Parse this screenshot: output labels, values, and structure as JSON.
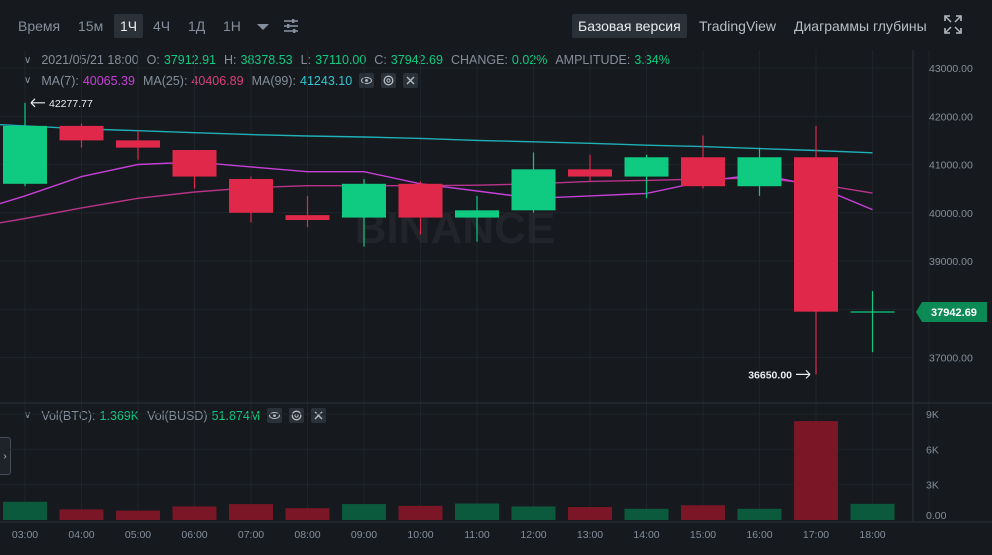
{
  "toolbar": {
    "intervals": [
      "Время",
      "15м",
      "1Ч",
      "4Ч",
      "1Д",
      "1Н"
    ],
    "active_interval": "1Ч",
    "views": [
      "Базовая версия",
      "TradingView",
      "Диаграммы глубины"
    ],
    "active_view": "Базовая версия"
  },
  "legend": {
    "date": "2021/05/21 18:00",
    "o_label": "O:",
    "o": "37912.91",
    "h_label": "H:",
    "h": "38378.53",
    "l_label": "L:",
    "l": "37110.00",
    "c_label": "C:",
    "c": "37942.69",
    "change_label": "CHANGE:",
    "change": "0.02%",
    "amp_label": "AMPLITUDE:",
    "amp": "3.34%",
    "ma7_label": "MA(7):",
    "ma7": "40065.39",
    "ma25_label": "MA(25):",
    "ma25": "40406.89",
    "ma99_label": "MA(99):",
    "ma99": "41243.10",
    "vol_btc_label": "Vol(BTC):",
    "vol_btc": "1.369K",
    "vol_busd_label": "Vol(BUSD)",
    "vol_busd": "51.874M"
  },
  "markers": {
    "high": "42277.77",
    "low": "36650.00",
    "last_price": "37942.69"
  },
  "watermark": "BINANCE",
  "colors": {
    "up": "#0ecb81",
    "down": "#e0294a",
    "ma7": "#c73fd9",
    "ma25": "#b8338a",
    "ma99": "#1fb0b8",
    "vol_up": "#0b5a3d",
    "vol_down": "#7a1626",
    "last_price_bg": "#0b8a55"
  },
  "chart_data": {
    "type": "candlestick",
    "x": [
      "03:00",
      "04:00",
      "05:00",
      "06:00",
      "07:00",
      "08:00",
      "09:00",
      "10:00",
      "11:00",
      "12:00",
      "13:00",
      "14:00",
      "15:00",
      "16:00",
      "17:00",
      "18:00"
    ],
    "price_axis": {
      "ticks": [
        "43000.00",
        "42000.00",
        "41000.00",
        "40000.00",
        "39000.00",
        "38000.00",
        "37000.00"
      ],
      "ylim": [
        36500,
        43250
      ]
    },
    "volume_axis": {
      "ticks": [
        "9K",
        "6K",
        "3K",
        "0.00"
      ],
      "ylim": [
        0,
        9000
      ]
    },
    "candles": [
      {
        "t": "03:00",
        "o": 40600,
        "h": 42278,
        "l": 40550,
        "c": 41800
      },
      {
        "t": "04:00",
        "o": 41800,
        "h": 41850,
        "l": 41350,
        "c": 41500
      },
      {
        "t": "05:00",
        "o": 41500,
        "h": 41700,
        "l": 41100,
        "c": 41350
      },
      {
        "t": "06:00",
        "o": 41300,
        "h": 41300,
        "l": 40500,
        "c": 40750
      },
      {
        "t": "07:00",
        "o": 40700,
        "h": 40750,
        "l": 39800,
        "c": 40000
      },
      {
        "t": "08:00",
        "o": 39950,
        "h": 40350,
        "l": 39700,
        "c": 39850
      },
      {
        "t": "09:00",
        "o": 39900,
        "h": 40700,
        "l": 39300,
        "c": 40600
      },
      {
        "t": "10:00",
        "o": 40600,
        "h": 40650,
        "l": 39550,
        "c": 39900
      },
      {
        "t": "11:00",
        "o": 39900,
        "h": 40350,
        "l": 39400,
        "c": 40050
      },
      {
        "t": "12:00",
        "o": 40050,
        "h": 41250,
        "l": 40000,
        "c": 40900
      },
      {
        "t": "13:00",
        "o": 40900,
        "h": 41200,
        "l": 40650,
        "c": 40750
      },
      {
        "t": "14:00",
        "o": 40750,
        "h": 41200,
        "l": 40300,
        "c": 41150
      },
      {
        "t": "15:00",
        "o": 41150,
        "h": 41600,
        "l": 40500,
        "c": 40550
      },
      {
        "t": "16:00",
        "o": 40550,
        "h": 41350,
        "l": 40350,
        "c": 41150
      },
      {
        "t": "17:00",
        "o": 41150,
        "h": 41800,
        "l": 36650,
        "c": 37950
      },
      {
        "t": "18:00",
        "o": 37913,
        "h": 38379,
        "l": 37110,
        "c": 37943
      }
    ],
    "volume": [
      1550,
      900,
      800,
      1150,
      1350,
      1000,
      1350,
      1200,
      1400,
      1150,
      1100,
      950,
      1250,
      950,
      8400,
      1369
    ],
    "ma7": [
      40350,
      40750,
      41000,
      41050,
      40950,
      40850,
      40850,
      40600,
      40450,
      40300,
      40350,
      40400,
      40650,
      40800,
      40550,
      40065
    ],
    "ma25": [
      39880,
      40100,
      40300,
      40430,
      40520,
      40560,
      40560,
      40560,
      40570,
      40600,
      40650,
      40670,
      40700,
      40720,
      40600,
      40407
    ],
    "ma99": [
      41800,
      41740,
      41700,
      41660,
      41620,
      41590,
      41570,
      41540,
      41500,
      41470,
      41440,
      41400,
      41370,
      41330,
      41290,
      41243
    ]
  }
}
